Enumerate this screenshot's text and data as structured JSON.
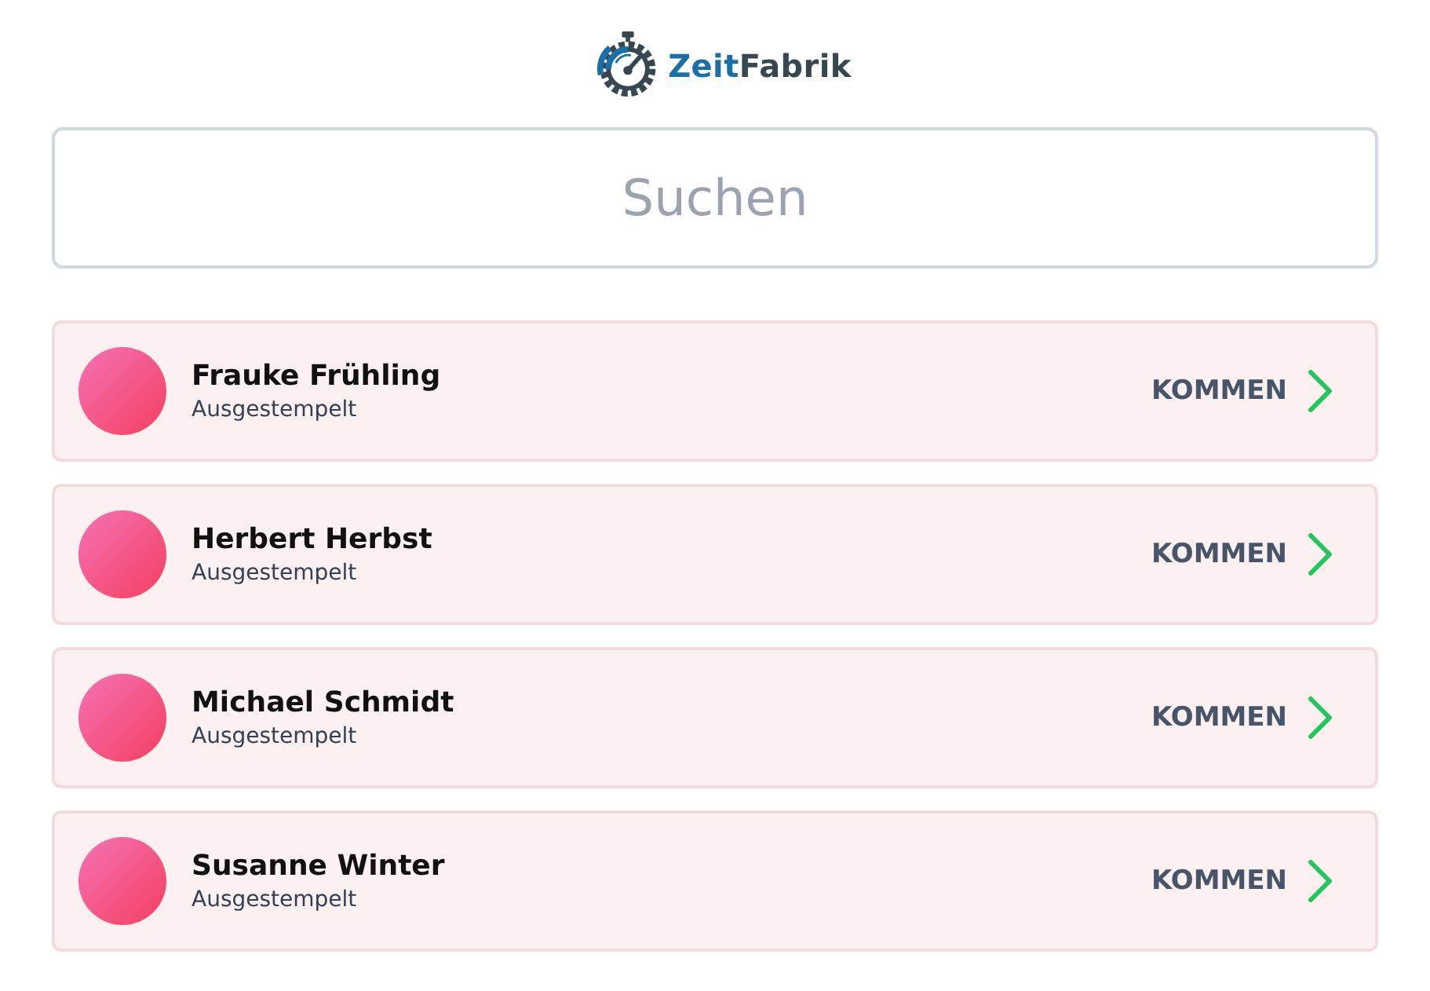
{
  "logo": {
    "name_parts": [
      "Zeit",
      "Fabrik"
    ]
  },
  "search": {
    "placeholder": "Suchen"
  },
  "employees": [
    {
      "name": "Frauke Frühling",
      "status": "Ausgestempelt",
      "action": "KOMMEN"
    },
    {
      "name": "Herbert Herbst",
      "status": "Ausgestempelt",
      "action": "KOMMEN"
    },
    {
      "name": "Michael Schmidt",
      "status": "Ausgestempelt",
      "action": "KOMMEN"
    },
    {
      "name": "Susanne Winter",
      "status": "Ausgestempelt",
      "action": "KOMMEN"
    }
  ]
}
